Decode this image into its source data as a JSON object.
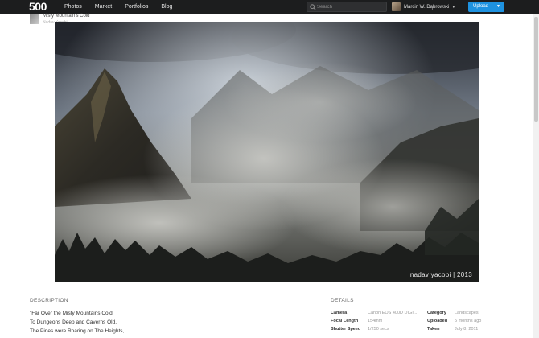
{
  "nav": {
    "logo": "500",
    "items": [
      "Photos",
      "Market",
      "Portfolios",
      "Blog"
    ],
    "search_placeholder": "Search",
    "user_name": "Marcin W. Dąbrowski",
    "upload_label": "Upload"
  },
  "photo": {
    "title": "Misty Mountain's Cold",
    "author": "Nadav Yacobi",
    "watermark": "nadav yacobi | 2013"
  },
  "description": {
    "heading": "DESCRIPTION",
    "lines": [
      "\"Far Over the Misty Mountains Cold,",
      "To Dungeons Deep and Caverns Old,",
      "The Pines were Roaring on The Heights,"
    ]
  },
  "details": {
    "heading": "DETAILS",
    "rows": [
      {
        "k1": "Camera",
        "v1": "Canon EOS 400D DIGI...",
        "k2": "Category",
        "v2": "Landscapes"
      },
      {
        "k1": "Focal Length",
        "v1": "154mm",
        "k2": "Uploaded",
        "v2": "5 months ago"
      },
      {
        "k1": "Shutter Speed",
        "v1": "1/250 secs",
        "k2": "Taken",
        "v2": "July 8, 2011"
      }
    ]
  }
}
